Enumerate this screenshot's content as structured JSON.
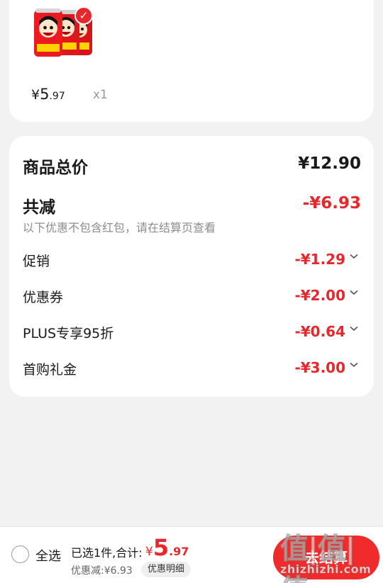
{
  "product": {
    "image": "wangzai-milk-cans",
    "selected_icon": "check-icon",
    "price_yen": "¥",
    "price_int": "5",
    "price_dec": ".97",
    "qty": "x1"
  },
  "summary": {
    "total_label": "商品总价",
    "total_value": "¥12.90",
    "reduce_label": "共减",
    "reduce_value": "-¥6.93",
    "reduce_note": "以下优惠不包含红包，请在结算页查看",
    "discounts": [
      {
        "label": "促销",
        "value": "-¥1.29"
      },
      {
        "label": "优惠券",
        "value": "-¥2.00"
      },
      {
        "label": "PLUS专享95折",
        "value": "-¥0.64"
      },
      {
        "label": "首购礼金",
        "value": "-¥3.00"
      }
    ]
  },
  "bottom_bar": {
    "select_all": "全选",
    "selected_count": "已选1件,合计:",
    "sum_yen": "¥",
    "sum_int": "5",
    "sum_dec": ".97",
    "saved": "优惠减:¥6.93",
    "detail_chip": "优惠明细",
    "checkout": "去结算"
  },
  "watermark": {
    "glyphs": "值|值|值",
    "text": "zhizhizhi.com"
  },
  "colors": {
    "accent_red": "#e8262b",
    "page_bg": "#f2f2f2"
  }
}
